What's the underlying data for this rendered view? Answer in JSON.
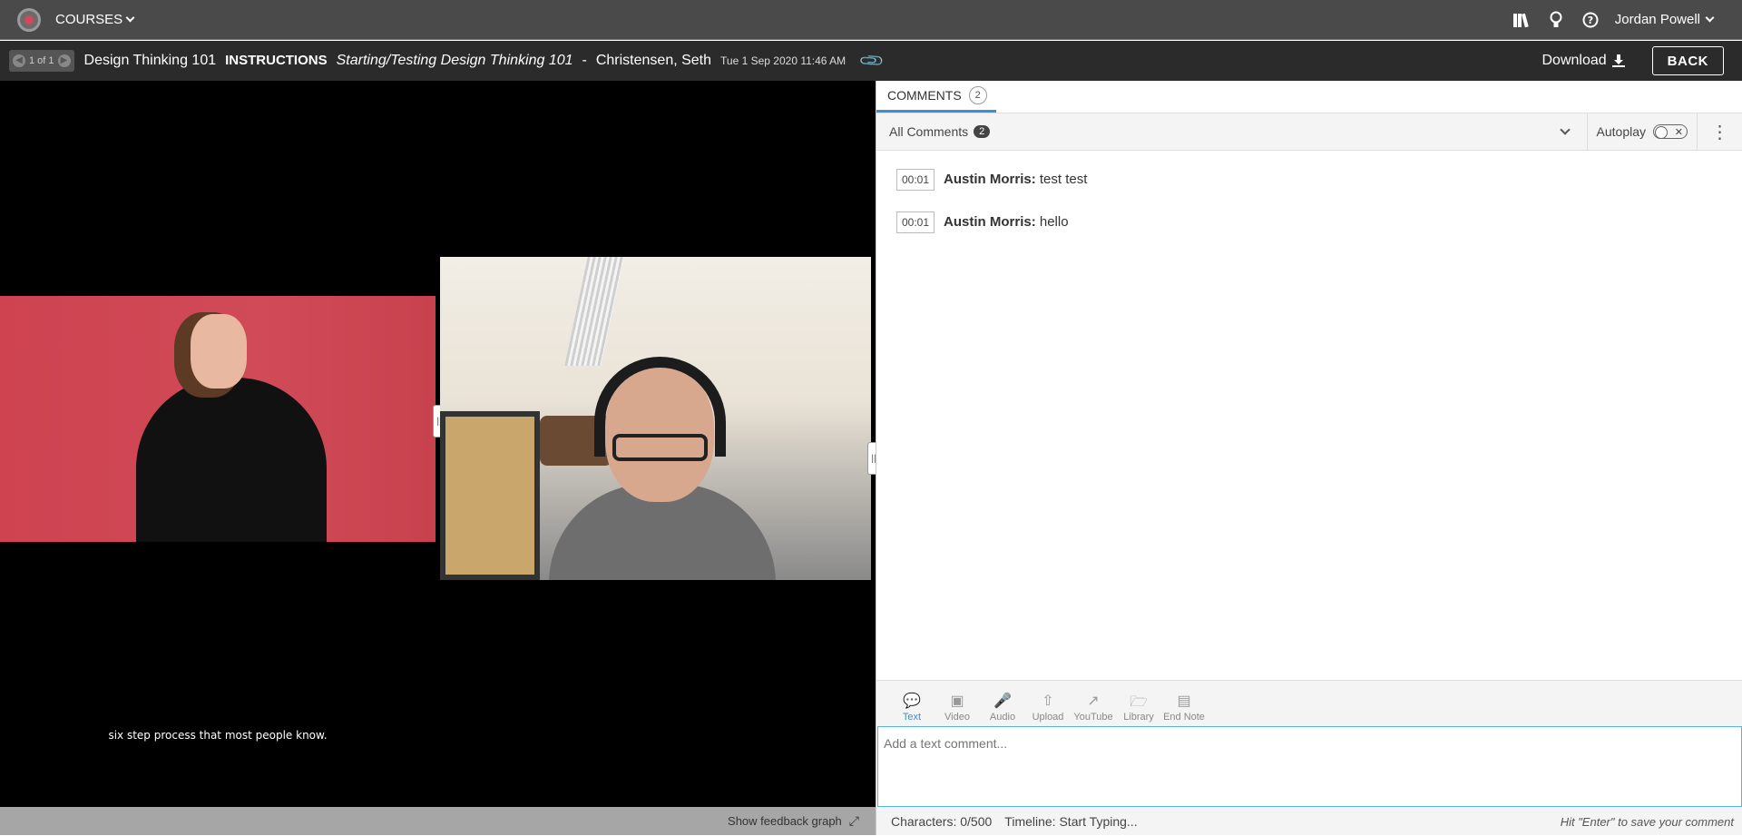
{
  "topnav": {
    "courses_label": "COURSES",
    "user_name": "Jordan Powell",
    "icons": [
      "library-icon",
      "lightbulb-icon",
      "help-icon"
    ]
  },
  "subheader": {
    "pager": "1 of 1",
    "course": "Design Thinking 101",
    "section": "INSTRUCTIONS",
    "assignment": "Starting/Testing Design Thinking 101",
    "separator": "-",
    "student": "Christensen, Seth",
    "timestamp": "Tue 1 Sep 2020  11:46 AM",
    "download_label": "Download",
    "back_label": "BACK"
  },
  "video": {
    "caption": "six step process that most people know.",
    "feedback_graph_label": "Show feedback graph"
  },
  "comments": {
    "tab_label": "COMMENTS",
    "tab_count": "2",
    "filter_label": "All Comments",
    "filter_count": "2",
    "autoplay_label": "Autoplay",
    "items": [
      {
        "time": "00:01",
        "author": "Austin Morris:",
        "text": "test test"
      },
      {
        "time": "00:01",
        "author": "Austin Morris:",
        "text": "hello"
      }
    ]
  },
  "composer": {
    "types": [
      {
        "label": "Text",
        "icon": "speech-bubble-icon",
        "active": true
      },
      {
        "label": "Video",
        "icon": "video-camera-icon"
      },
      {
        "label": "Audio",
        "icon": "microphone-icon"
      },
      {
        "label": "Upload",
        "icon": "upload-arrow-icon"
      },
      {
        "label": "YouTube",
        "icon": "external-link-icon"
      },
      {
        "label": "Library",
        "icon": "folder-icon"
      },
      {
        "label": "End Note",
        "icon": "note-icon"
      }
    ],
    "placeholder": "Add a text comment...",
    "characters": "Characters: 0/500",
    "timeline": "Timeline:  Start Typing...",
    "hint": "Hit \"Enter\" to save your comment"
  },
  "colors": {
    "accent": "#3b8ed8",
    "brand": "#d4465a",
    "nav": "#4a4a4a"
  }
}
